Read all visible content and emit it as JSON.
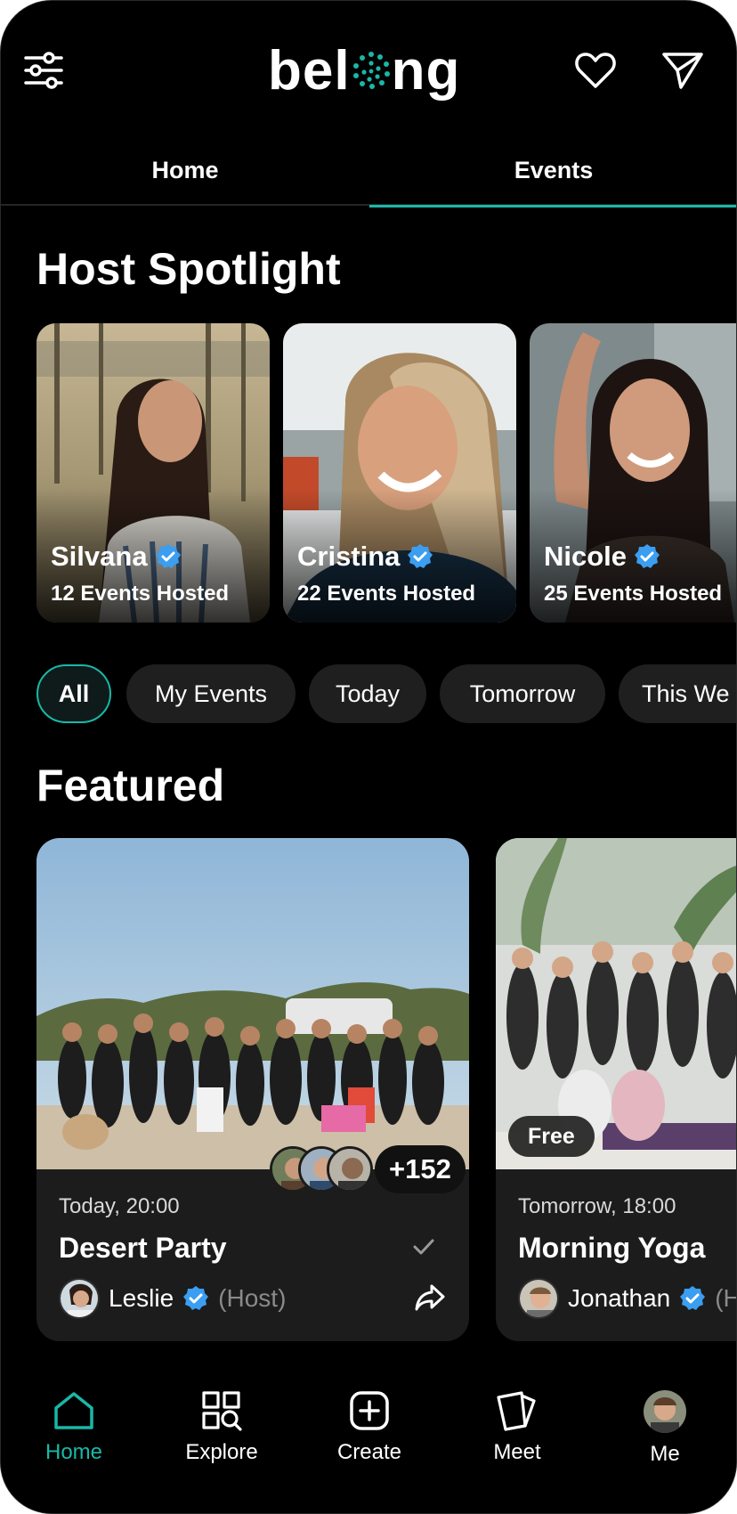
{
  "app": {
    "logo_left": "bel",
    "logo_right": "ng"
  },
  "colors": {
    "accent": "#19b8a8",
    "verified": "#3b9ef0",
    "background": "#000000",
    "card": "#1c1c1c",
    "chip": "#1f1f1f"
  },
  "header": {
    "filter_icon": "sliders-icon",
    "favorites_icon": "heart-icon",
    "messages_icon": "paper-plane-icon"
  },
  "tabs": [
    {
      "label": "Home",
      "active": false
    },
    {
      "label": "Events",
      "active": true
    }
  ],
  "host_spotlight": {
    "title": "Host Spotlight",
    "hosts": [
      {
        "name": "Silvana",
        "events": "12 Events Hosted",
        "verified": true
      },
      {
        "name": "Cristina",
        "events": "22 Events Hosted",
        "verified": true
      },
      {
        "name": "Nicole",
        "events": "25 Events Hosted",
        "verified": true
      }
    ]
  },
  "filters": [
    {
      "label": "All",
      "active": true
    },
    {
      "label": "My Events",
      "active": false
    },
    {
      "label": "Today",
      "active": false
    },
    {
      "label": "Tomorrow",
      "active": false
    },
    {
      "label": "This We",
      "active": false
    }
  ],
  "featured": {
    "title": "Featured",
    "events": [
      {
        "time": "Today, 20:00",
        "title": "Desert Party",
        "host": "Leslie",
        "host_role": "(Host)",
        "attendees_more": "+152",
        "joined": true
      },
      {
        "time": "Tomorrow, 18:00",
        "title": "Morning Yoga",
        "host": "Jonathan",
        "host_role": "(H",
        "price_badge": "Free"
      }
    ]
  },
  "bottom_nav": [
    {
      "label": "Home",
      "icon": "home-icon",
      "active": true
    },
    {
      "label": "Explore",
      "icon": "explore-icon",
      "active": false
    },
    {
      "label": "Create",
      "icon": "plus-square-icon",
      "active": false
    },
    {
      "label": "Meet",
      "icon": "cards-icon",
      "active": false
    },
    {
      "label": "Me",
      "icon": "avatar",
      "active": false
    }
  ]
}
